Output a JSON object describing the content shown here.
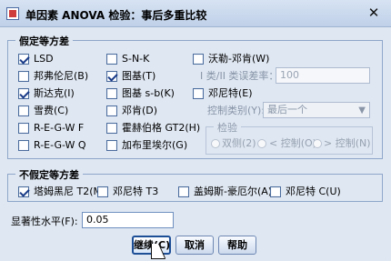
{
  "window": {
    "title": "单因素 ANOVA 检验：事后多重比较",
    "close_symbol": "✕"
  },
  "equal_variances": {
    "legend": "假定等方差",
    "options": [
      {
        "label": "LSD",
        "checked": true
      },
      {
        "label": "S-N-K",
        "checked": false
      },
      {
        "label": "沃勒-邓肯(W)",
        "checked": false
      },
      {
        "label": "邦弗伦尼(B)",
        "checked": false
      },
      {
        "label": "图基(T)",
        "checked": true
      },
      {
        "label": "斯达克(I)",
        "checked": true
      },
      {
        "label": "图基 s-b(K)",
        "checked": false
      },
      {
        "label": "邓尼特(E)",
        "checked": false
      },
      {
        "label": "雪费(C)",
        "checked": false
      },
      {
        "label": "邓肯(D)",
        "checked": false
      },
      {
        "label": "R-E-G-W F",
        "checked": false
      },
      {
        "label": "霍赫伯格 GT2(H)",
        "checked": false
      },
      {
        "label": "R-E-G-W Q",
        "checked": false
      },
      {
        "label": "加布里埃尔(G)",
        "checked": false
      }
    ],
    "error_ratio_label": "I 类/II 类误差率：",
    "error_ratio_value": "100",
    "control_category_label": "控制类别(Y):",
    "control_category_value": "最后一个",
    "test_legend": "检验",
    "test_options": [
      "双侧(2)",
      "< 控制(O)",
      "> 控制(N)"
    ]
  },
  "unequal_variances": {
    "legend": "不假定等方差",
    "options": [
      {
        "label": "塔姆黑尼 T2(M)",
        "checked": true
      },
      {
        "label": "邓尼特 T3",
        "checked": false
      },
      {
        "label": "盖姆斯-豪厄尔(A)",
        "checked": false
      },
      {
        "label": "邓尼特 C(U)",
        "checked": false
      }
    ]
  },
  "significance": {
    "label": "显著性水平(F):",
    "value": "0.05"
  },
  "buttons": {
    "continue": "继续(C)",
    "cancel": "取消",
    "help": "帮助"
  },
  "icons": {
    "app": "spss-dialog-icon",
    "close": "close-icon",
    "cursor": "mouse-pointer-icon"
  }
}
